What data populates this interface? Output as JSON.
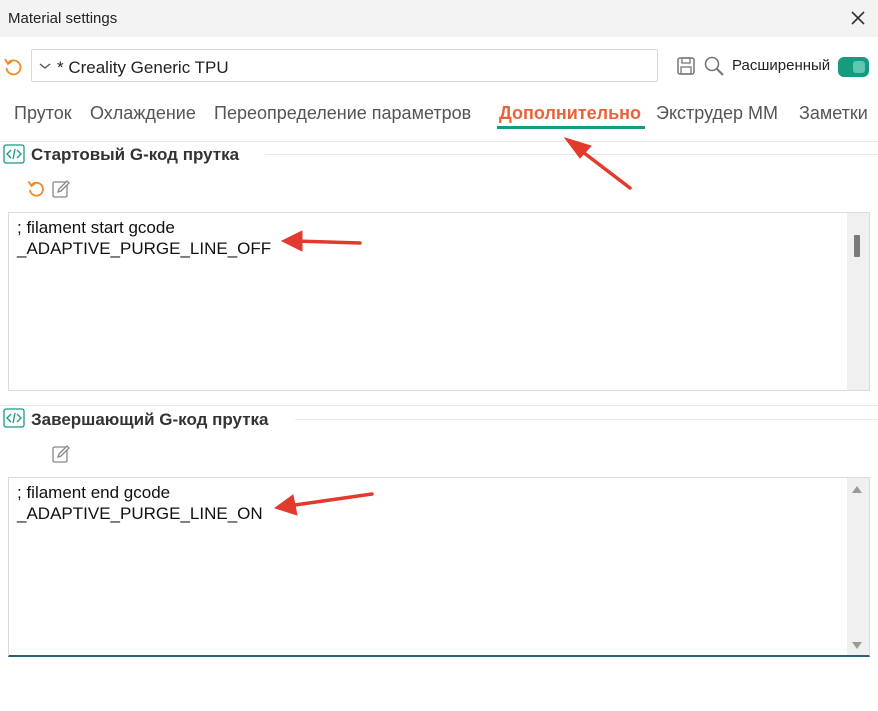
{
  "window": {
    "title": "Material settings"
  },
  "preset": {
    "value": "* Creality Generic TPU"
  },
  "toolbar": {
    "advanced_label": "Расширенный",
    "advanced_on": true
  },
  "tabs": [
    {
      "label": "Пруток",
      "active": false
    },
    {
      "label": "Охлаждение",
      "active": false
    },
    {
      "label": "Переопределение параметров",
      "active": false
    },
    {
      "label": "Дополнительно",
      "active": true
    },
    {
      "label": "Экструдер ММ",
      "active": false
    },
    {
      "label": "Заметки",
      "active": false
    }
  ],
  "start_gcode": {
    "title": "Стартовый G-код прутка",
    "lines": [
      "; filament start gcode",
      "_ADAPTIVE_PURGE_LINE_OFF"
    ]
  },
  "end_gcode": {
    "title": "Завершающий G-код прутка",
    "lines": [
      "; filament end gcode",
      "_ADAPTIVE_PURGE_LINE_ON"
    ]
  },
  "colors": {
    "accent": "#179b80",
    "active_tab": "#e8633a",
    "reset_icon": "#f08a24",
    "annotation_arrow": "#e23b2e"
  },
  "icons": [
    "close-icon",
    "reset-icon",
    "chevron-down-icon",
    "save-icon",
    "search-icon",
    "code-icon",
    "edit-icon"
  ]
}
